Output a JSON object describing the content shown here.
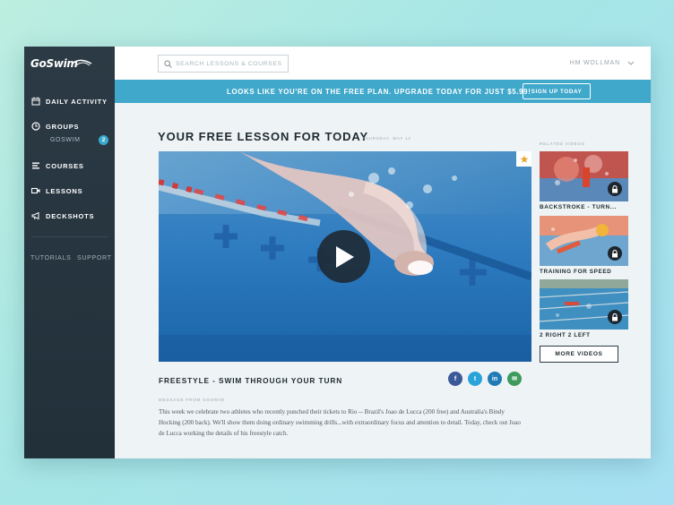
{
  "app": {
    "logo_text": "GoSwim"
  },
  "sidebar": {
    "items": [
      {
        "label": "DAILY ACTIVITY",
        "icon": "calendar-icon"
      },
      {
        "label": "GROUPS",
        "icon": "clock-icon"
      },
      {
        "label": "COURSES",
        "icon": "list-icon"
      },
      {
        "label": "LESSONS",
        "icon": "video-camera-icon"
      },
      {
        "label": "DECKSHOTS",
        "icon": "megaphone-icon"
      }
    ],
    "group_sub": {
      "label": "GOSWIM",
      "count": "2"
    },
    "links": {
      "tutorials": "TUTORIALS",
      "support": "SUPPORT"
    }
  },
  "search": {
    "placeholder": "SEARCH LESSONS & COURSES",
    "value": ""
  },
  "user": {
    "name": "HM WOLLMAN"
  },
  "banner": {
    "text": "LOOKS LIKE YOU'RE ON THE FREE PLAN. UPGRADE TODAY FOR JUST $5.99!",
    "button": "SIGN UP TODAY"
  },
  "lesson": {
    "heading": "YOUR FREE LESSON FOR TODAY",
    "date": "THURSDAY, MAY 12",
    "video_title": "FREESTYLE - SWIM THROUGH YOUR TURN",
    "message_label": "MESSAGE FROM GOSWIM",
    "message": "This week we celebrate two athletes who recently punched their tickets to Rio -- Brazil's Joao de Lucca (200 free) and Australia's Bindy Hocking (200 back). We'll show them doing ordinary swimming drills...with extraordinary focus and attention to detail. Today, check out Joao de Lucca working the details of his freestyle catch."
  },
  "share": [
    {
      "name": "facebook-icon",
      "glyph": "f",
      "color": "#3b5998"
    },
    {
      "name": "twitter-icon",
      "glyph": "t",
      "color": "#2aa3d9"
    },
    {
      "name": "linkedin-icon",
      "glyph": "in",
      "color": "#1f7bb6"
    },
    {
      "name": "email-icon",
      "glyph": "✉",
      "color": "#3e9a5d"
    }
  ],
  "related": {
    "label": "RELATED VIDEOS",
    "items": [
      {
        "title": "BACKSTROKE - TURN..."
      },
      {
        "title": "TRAINING FOR SPEED"
      },
      {
        "title": "2 RIGHT 2 LEFT"
      }
    ],
    "more_button": "MORE VIDEOS"
  },
  "colors": {
    "accent": "#40a8cb",
    "sidebar": "#2c3a45",
    "star": "#e8a838"
  }
}
